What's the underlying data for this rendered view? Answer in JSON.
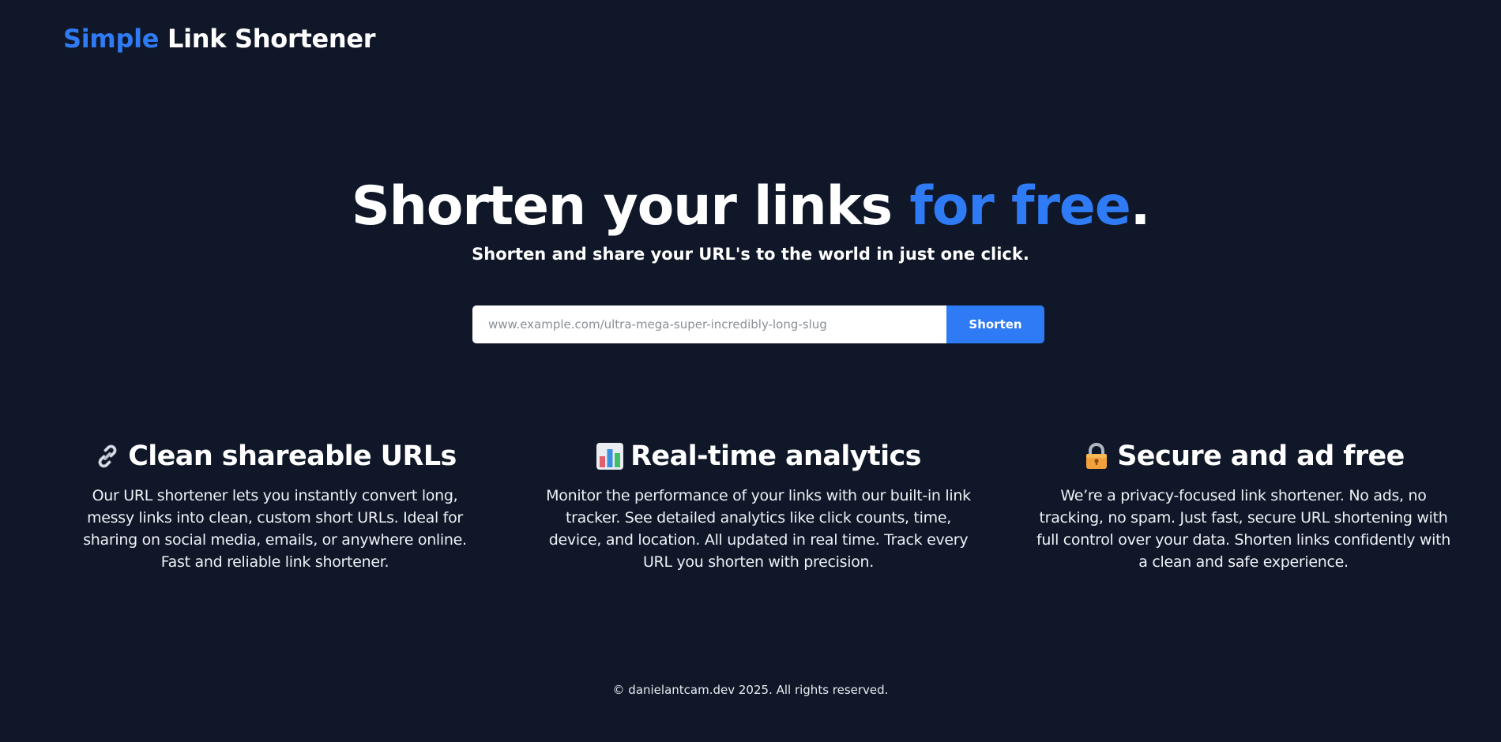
{
  "header": {
    "brand_accent": "Simple",
    "brand_rest": "Link Shortener"
  },
  "hero": {
    "title_main": "Shorten your links ",
    "title_accent": "for free",
    "title_end": ".",
    "subtitle": "Shorten and share your URL's to the world in just one click."
  },
  "form": {
    "input_value": "",
    "input_placeholder": "www.example.com/ultra-mega-super-incredibly-long-slug",
    "button_label": "Shorten"
  },
  "features": [
    {
      "icon": "link-icon",
      "title": "Clean shareable URLs",
      "description": "Our URL shortener lets you instantly convert long, messy links into clean, custom short URLs. Ideal for sharing on social media, emails, or anywhere online. Fast and reliable link shortener."
    },
    {
      "icon": "bar-chart-icon",
      "title": "Real-time analytics",
      "description": "Monitor the performance of your links with our built-in link tracker. See detailed analytics like click counts, time, device, and location. All updated in real time. Track every URL you shorten with precision."
    },
    {
      "icon": "lock-icon",
      "title": "Secure and ad free",
      "description": "We’re a privacy-focused link shortener. No ads, no tracking, no spam. Just fast, secure URL shortening with full control over your data. Shorten links confidently with a clean and safe experience."
    }
  ],
  "footer": {
    "text": "© danielantcam.dev 2025. All rights reserved."
  },
  "colors": {
    "background": "#0f1728",
    "accent": "#2f7bf5",
    "text": "#ffffff"
  }
}
